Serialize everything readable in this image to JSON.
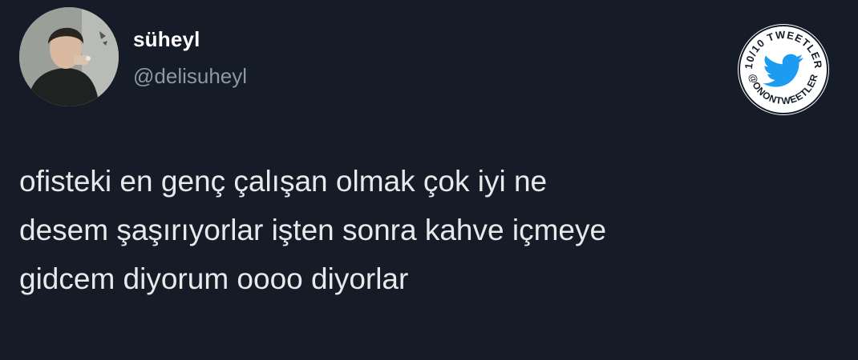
{
  "author": {
    "display_name": "süheyl",
    "handle": "@delisuheyl"
  },
  "tweet": {
    "text": "ofisteki en genç çalışan olmak çok iyi ne\ndesem şaşırıyorlar işten sonra kahve içmeye\ngidcem diyorum oooo diyorlar"
  },
  "badge": {
    "top_text": "10/10 TWEETLER",
    "bottom_text": "@ONONTWEETLER",
    "bird_color": "#1d9bf0"
  },
  "colors": {
    "background": "#151c28",
    "text": "#e7e9ea",
    "secondary": "#8b98a5"
  }
}
